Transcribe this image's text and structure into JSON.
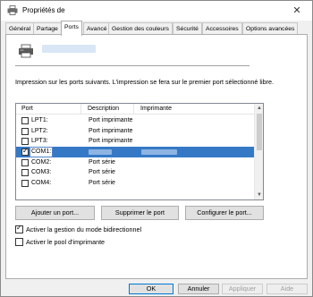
{
  "window": {
    "title": "Propriétés de",
    "close_glyph": "✕"
  },
  "tabs": [
    {
      "label": "Général"
    },
    {
      "label": "Partage"
    },
    {
      "label": "Ports",
      "active": true
    },
    {
      "label": "Avancé"
    },
    {
      "label": "Gestion des couleurs"
    },
    {
      "label": "Sécurité"
    },
    {
      "label": "Accessoires"
    },
    {
      "label": "Options avancées"
    }
  ],
  "ports_tab": {
    "info_text": "Impression sur les ports suivants. L'impression se fera sur le premier port sélectionné libre.",
    "columns": {
      "port": "Port",
      "description": "Description",
      "printer": "Imprimante"
    },
    "rows": [
      {
        "port": "LPT1:",
        "description": "Port imprimante",
        "checked": false
      },
      {
        "port": "LPT2:",
        "description": "Port imprimante",
        "checked": false
      },
      {
        "port": "LPT3:",
        "description": "Port imprimante",
        "checked": false
      },
      {
        "port": "COM1:",
        "description": "",
        "checked": true,
        "selected": true
      },
      {
        "port": "COM2:",
        "description": "Port série",
        "checked": false
      },
      {
        "port": "COM3:",
        "description": "Port série",
        "checked": false
      },
      {
        "port": "COM4:",
        "description": "Port série",
        "checked": false
      }
    ],
    "buttons": {
      "add_port": "Ajouter un port...",
      "delete_port": "Supprimer le port",
      "configure_port": "Configurer le port..."
    },
    "checkboxes": {
      "bidirectional": {
        "label": "Activer la gestion du mode bidirectionnel",
        "checked": true
      },
      "pool": {
        "label": "Activer le pool d'imprimante",
        "checked": false
      }
    }
  },
  "footer": {
    "ok": "OK",
    "cancel": "Annuler",
    "apply": "Appliquer",
    "help": "Aide"
  },
  "colors": {
    "selection": "#3579c6",
    "accent": "#0078d7"
  }
}
